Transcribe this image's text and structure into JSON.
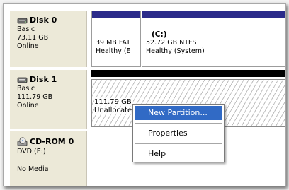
{
  "disks": [
    {
      "name": "Disk 0",
      "type": "Basic",
      "size": "73.11 GB",
      "status": "Online",
      "partitions": [
        {
          "size": "39 MB FAT",
          "status": "Healthy (E"
        },
        {
          "drive": "(C:)",
          "size": "52.72 GB NTFS",
          "status": "Healthy (System)"
        }
      ]
    },
    {
      "name": "Disk 1",
      "type": "Basic",
      "size": "111.79 GB",
      "status": "Online",
      "partitions": [
        {
          "size": "111.79 GB",
          "status": "Unallocated"
        }
      ]
    }
  ],
  "cdrom": {
    "name": "CD-ROM 0",
    "type": "DVD (E:)",
    "status": "No Media"
  },
  "context_menu": {
    "items": [
      {
        "label": "New Partition...",
        "selected": true
      },
      {
        "label": "Properties",
        "selected": false
      },
      {
        "label": "Help",
        "selected": false
      }
    ]
  },
  "colors": {
    "primary_partition_bar": "#2a2a8a",
    "unallocated_bar": "#000000",
    "selection": "#316ac5",
    "label_background": "#ece9d8"
  },
  "icons": [
    "disk-icon",
    "cdrom-icon"
  ]
}
